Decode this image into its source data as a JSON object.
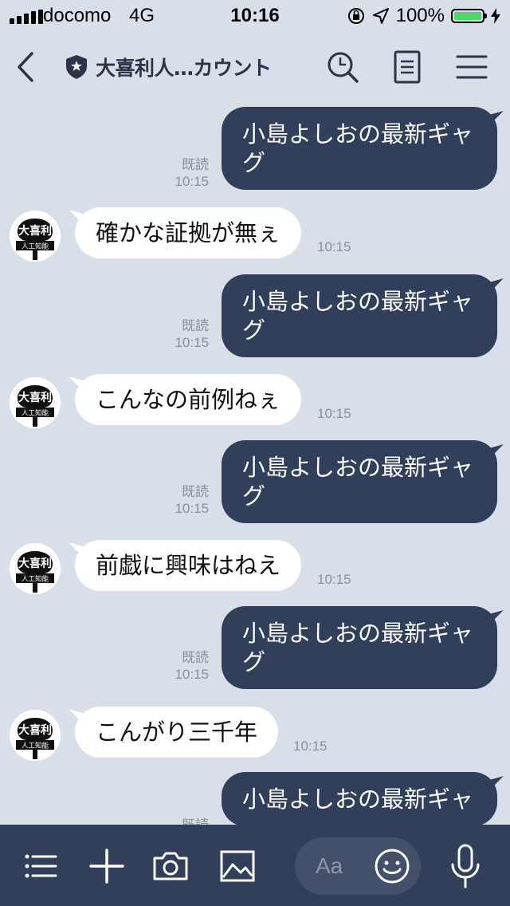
{
  "status_bar": {
    "carrier": "docomo",
    "network": "4G",
    "time": "10:16",
    "battery": "100%",
    "battery_level": 1.0
  },
  "header": {
    "title": "大喜利人…カウント",
    "icons": [
      "back-icon",
      "shield-icon",
      "search-icon",
      "notes-icon",
      "menu-icon"
    ]
  },
  "messages": [
    {
      "side": "out",
      "text": "小島よしおの最新ギャグ",
      "read": "既読",
      "time": "10:15"
    },
    {
      "side": "in",
      "text": "確かな証拠が無ぇ",
      "time": "10:15"
    },
    {
      "side": "out",
      "text": "小島よしおの最新ギャグ",
      "read": "既読",
      "time": "10:15"
    },
    {
      "side": "in",
      "text": "こんなの前例ねぇ",
      "time": "10:15"
    },
    {
      "side": "out",
      "text": "小島よしおの最新ギャグ",
      "read": "既読",
      "time": "10:15"
    },
    {
      "side": "in",
      "text": "前戯に興味はねえ",
      "time": "10:15"
    },
    {
      "side": "out",
      "text": "小島よしおの最新ギャグ",
      "read": "既読",
      "time": "10:15"
    },
    {
      "side": "in",
      "text": "こんがり三千年",
      "time": "10:15"
    },
    {
      "side": "out",
      "text": "小島よしおの最新ギャ",
      "read": "既読",
      "time": ""
    }
  ],
  "avatar": {
    "text_top": "大喜利",
    "text_bottom": "人工知能"
  },
  "composer": {
    "placeholder": "Aa",
    "icons": [
      "more-icon",
      "plus-icon",
      "camera-icon",
      "image-icon",
      "smile-icon",
      "mic-icon"
    ]
  },
  "colors": {
    "background": "#d8dfe8",
    "outgoing_bubble": "#323f5b",
    "bottom_bar": "#323f5b",
    "battery": "#4cd964"
  }
}
